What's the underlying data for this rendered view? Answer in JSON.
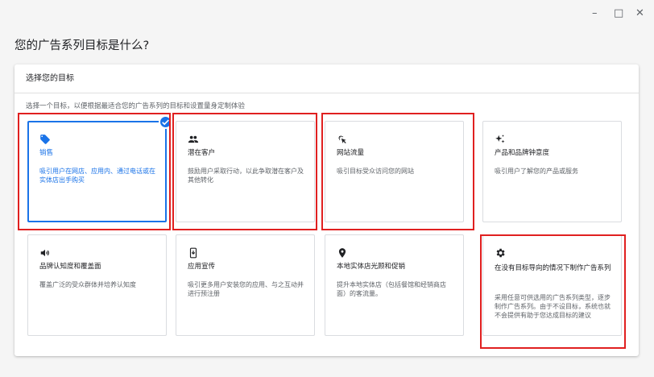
{
  "window": {
    "minimize": "–",
    "maximize": "□",
    "close": "✕"
  },
  "heading": "您的广告系列目标是什么?",
  "panel": {
    "header": "选择您的目标",
    "subtitle": "选择一个目标，以便根据最适合您的广告系列的目标和设置量身定制体验"
  },
  "goals": [
    {
      "icon": "tag-icon",
      "title": "销售",
      "desc": "吸引用户在网店、应用内、通过电话或在实体店出手购买",
      "selected": true
    },
    {
      "icon": "people-icon",
      "title": "潜在客户",
      "desc": "鼓励用户采取行动，以此争取潜在客户及其他转化",
      "selected": false
    },
    {
      "icon": "click-icon",
      "title": "网站流量",
      "desc": "吸引目标受众访问您的网站",
      "selected": false
    },
    {
      "icon": "sparkle-icon",
      "title": "产品和品牌钟意度",
      "desc": "吸引用户了解您的产品或服务",
      "selected": false
    },
    {
      "icon": "speaker-icon",
      "title": "品牌认知度和覆盖面",
      "desc": "覆盖广泛的受众群体并培养认知度",
      "selected": false
    },
    {
      "icon": "phone-icon",
      "title": "应用宣传",
      "desc": "吸引更多用户安装您的应用、与之互动并进行预注册",
      "selected": false
    },
    {
      "icon": "location-pin-icon",
      "title": "本地实体店光顾和促销",
      "desc": "提升本地实体店（包括餐馆和经销商店面）的客流量。",
      "selected": false
    },
    {
      "icon": "gear-icon",
      "title": "在没有目标导向的情况下制作广告系列",
      "desc": "采用任意可供选用的广告系列类型，逐步制作广告系列。由于不设目标，系统也就不会提供有助于您达成目标的建议",
      "selected": false
    }
  ],
  "colors": {
    "accent": "#1a73e8",
    "highlight": "#e02020",
    "border": "#dadce0"
  }
}
